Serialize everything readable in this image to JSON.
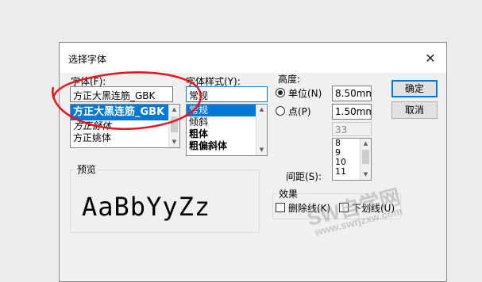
{
  "dialog": {
    "title": "选择字体",
    "close_glyph": "✕"
  },
  "font": {
    "label": "字体(F):",
    "value": "方正大黑连筋_GBK",
    "items": [
      "方正大黑连筋_GBK",
      "方正舒体",
      "方正姚体"
    ],
    "selected_index": 0
  },
  "style": {
    "label": "字体样式(Y):",
    "value": "常规",
    "items": [
      "常规",
      "倾斜",
      "粗体",
      "粗偏斜体"
    ],
    "selected_index": 0
  },
  "height": {
    "label": "高度:",
    "unit_label": "单位(N)",
    "unit_value": "8.50mm",
    "point_label": "点(P)",
    "point_value": "1.50mm",
    "size_value": "33",
    "size_items": [
      "8",
      "9",
      "10",
      "11"
    ],
    "selected_option": "unit"
  },
  "spacing": {
    "label": "间距(S):"
  },
  "buttons": {
    "ok": "确定",
    "cancel": "取消"
  },
  "preview": {
    "label": "预览",
    "sample": "AaBbYyZz"
  },
  "effects": {
    "label": "效果",
    "strikethrough": "删除线(K)",
    "underline": "下划线(U)"
  },
  "watermark": {
    "main": "SW自学网",
    "url": "www.swrjzxw.com"
  },
  "colors": {
    "accent": "#0078d7",
    "annotation": "#e8141e"
  }
}
